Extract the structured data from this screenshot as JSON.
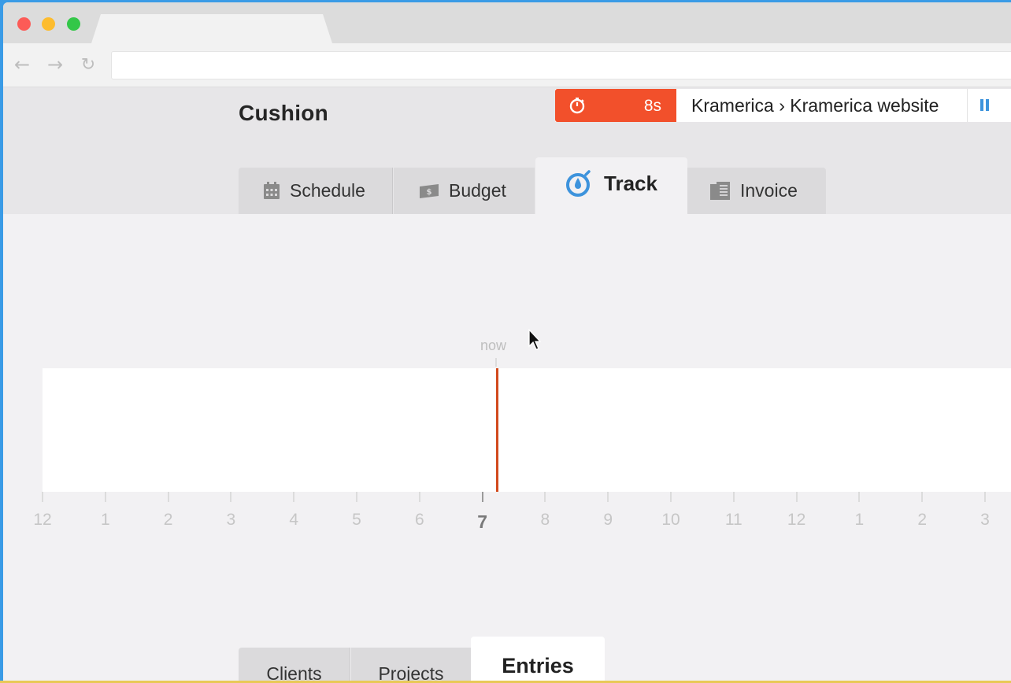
{
  "browser": {
    "back_icon": "back-arrow-icon",
    "forward_icon": "forward-arrow-icon",
    "reload_icon": "reload-icon",
    "address": ""
  },
  "app": {
    "name": "Cushion",
    "colors": {
      "accent_timer": "#f2502b",
      "track_icon": "#3d93dc",
      "now_line": "#d24a1e"
    }
  },
  "timer": {
    "elapsed": "8s",
    "project": "Kramerica › Kramerica website",
    "icon": "stopwatch-icon",
    "pause_icon": "pause-icon"
  },
  "tabs": [
    {
      "label": "Schedule",
      "icon": "calendar-icon"
    },
    {
      "label": "Budget",
      "icon": "money-icon"
    },
    {
      "label": "Track",
      "icon": "stopwatch-icon",
      "active": true
    },
    {
      "label": "Invoice",
      "icon": "invoice-icon"
    }
  ],
  "timeline": {
    "now_label": "now",
    "hours": [
      "12",
      "1",
      "2",
      "3",
      "4",
      "5",
      "6",
      "7",
      "8",
      "9",
      "10",
      "11",
      "12",
      "1",
      "2",
      "3"
    ],
    "current_hour": "7"
  },
  "subtabs": [
    {
      "label": "Clients"
    },
    {
      "label": "Projects"
    },
    {
      "label": "Entries",
      "active": true
    }
  ]
}
